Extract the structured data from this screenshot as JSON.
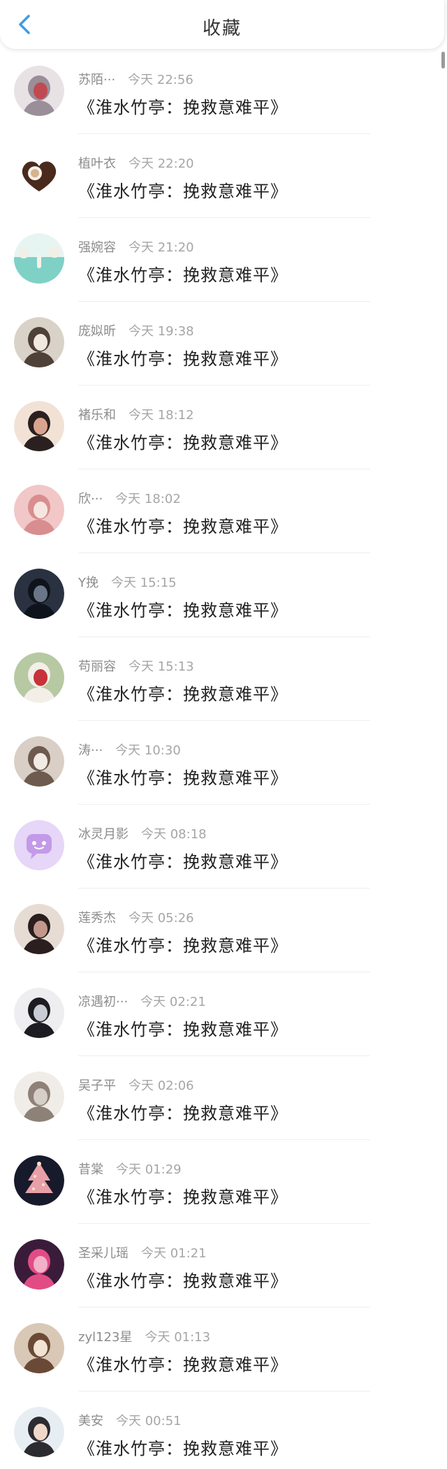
{
  "header": {
    "title": "收藏",
    "back_icon": "chevron-left-icon",
    "accent_color": "#3d9be9"
  },
  "items": [
    {
      "name": "苏陌···",
      "time": "今天 22:56",
      "content": "《淮水竹亭：挽救意难平》",
      "avatar": {
        "type": "photo",
        "c1": "#e8e2e4",
        "c2": "#9a8e98",
        "c3": "#c04a52"
      }
    },
    {
      "name": "植叶衣",
      "time": "今天 22:20",
      "content": "《淮水竹亭：挽救意难平》",
      "avatar": {
        "type": "coffee",
        "c1": "#ffffff",
        "c2": "#4a2a1c",
        "c3": "#d8b28c"
      }
    },
    {
      "name": "强婉容",
      "time": "今天 21:20",
      "content": "《淮水竹亭：挽救意难平》",
      "avatar": {
        "type": "sea",
        "c1": "#e6f5f2",
        "c2": "#7fd1c6",
        "c3": "#f2f0e6"
      }
    },
    {
      "name": "庞姒昕",
      "time": "今天 19:38",
      "content": "《淮水竹亭：挽救意难平》",
      "avatar": {
        "type": "photo",
        "c1": "#d9d2c8",
        "c2": "#4e4138",
        "c3": "#efe9e0"
      }
    },
    {
      "name": "褚乐和",
      "time": "今天 18:12",
      "content": "《淮水竹亭：挽救意难平》",
      "avatar": {
        "type": "photo",
        "c1": "#f2e2d6",
        "c2": "#2b2020",
        "c3": "#d9a48e"
      }
    },
    {
      "name": "欣···",
      "time": "今天 18:02",
      "content": "《淮水竹亭：挽救意难平》",
      "avatar": {
        "type": "photo",
        "c1": "#f1c7c7",
        "c2": "#d88e8e",
        "c3": "#f7e6df"
      }
    },
    {
      "name": "Y挽",
      "time": "今天 15:15",
      "content": "《淮水竹亭：挽救意难平》",
      "avatar": {
        "type": "photo",
        "c1": "#2a3242",
        "c2": "#0f141c",
        "c3": "#6b7588"
      }
    },
    {
      "name": "苟丽容",
      "time": "今天 15:13",
      "content": "《淮水竹亭：挽救意难平》",
      "avatar": {
        "type": "photo",
        "c1": "#b7c9a2",
        "c2": "#f3efe8",
        "c3": "#c8323a"
      }
    },
    {
      "name": "涛···",
      "time": "今天 10:30",
      "content": "《淮水竹亭：挽救意难平》",
      "avatar": {
        "type": "photo",
        "c1": "#d9cfc6",
        "c2": "#6e5a4e",
        "c3": "#f1ebe5"
      }
    },
    {
      "name": "冰灵月影",
      "time": "今天 08:18",
      "content": "《淮水竹亭：挽救意难平》",
      "avatar": {
        "type": "chat",
        "c1": "#e6d6f7",
        "c2": "#c39ae8",
        "c3": "#ffffff"
      }
    },
    {
      "name": "莲秀杰",
      "time": "今天 05:26",
      "content": "《淮水竹亭：挽救意难平》",
      "avatar": {
        "type": "photo",
        "c1": "#e7dcd4",
        "c2": "#2a1f1e",
        "c3": "#c2988c"
      }
    },
    {
      "name": "凉遇初···",
      "time": "今天 02:21",
      "content": "《淮水竹亭：挽救意难平》",
      "avatar": {
        "type": "photo",
        "c1": "#eeeef0",
        "c2": "#1c1c22",
        "c3": "#c9ccd4"
      }
    },
    {
      "name": "吴子平",
      "time": "今天 02:06",
      "content": "《淮水竹亭：挽救意难平》",
      "avatar": {
        "type": "photo",
        "c1": "#f0ece8",
        "c2": "#8e8278",
        "c3": "#d6cfc8"
      }
    },
    {
      "name": "昔棠",
      "time": "今天 01:29",
      "content": "《淮水竹亭：挽救意难平》",
      "avatar": {
        "type": "tree",
        "c1": "#161a2a",
        "c2": "#e8a0a8",
        "c3": "#f6e3c2"
      }
    },
    {
      "name": "圣采儿瑶",
      "time": "今天 01:21",
      "content": "《淮水竹亭：挽救意难平》",
      "avatar": {
        "type": "photo",
        "c1": "#3a1c3a",
        "c2": "#e24c84",
        "c3": "#f2b1c9"
      }
    },
    {
      "name": "zyl123星",
      "time": "今天 01:13",
      "content": "《淮水竹亭：挽救意难平》",
      "avatar": {
        "type": "photo",
        "c1": "#d9c8b6",
        "c2": "#6a4a36",
        "c3": "#f2e3d4"
      }
    },
    {
      "name": "美安",
      "time": "今天 00:51",
      "content": "《淮水竹亭：挽救意难平》",
      "avatar": {
        "type": "photo",
        "c1": "#e7eef3",
        "c2": "#2c2b31",
        "c3": "#f0d8c8"
      }
    }
  ]
}
